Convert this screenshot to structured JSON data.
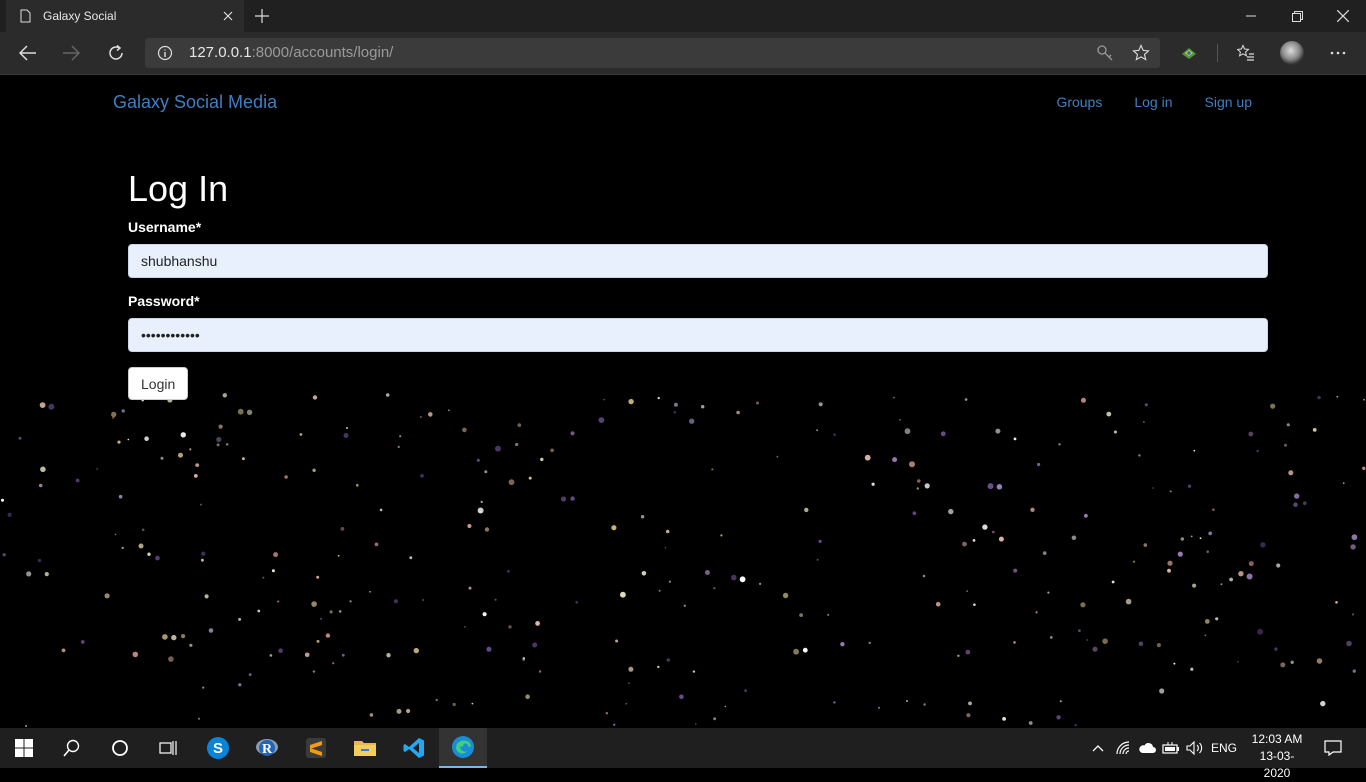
{
  "browser": {
    "tab_title": "Galaxy Social",
    "url_host": "127.0.0.1",
    "url_rest": ":8000/accounts/login/"
  },
  "navbar": {
    "brand": "Galaxy Social Media",
    "links": [
      {
        "label": "Groups"
      },
      {
        "label": "Log in"
      },
      {
        "label": "Sign up"
      }
    ]
  },
  "form": {
    "heading": "Log In",
    "username_label": "Username*",
    "username_value": "shubhanshu",
    "password_label": "Password*",
    "password_value": "••••••••••••",
    "submit_label": "Login"
  },
  "taskbar": {
    "language": "ENG",
    "time": "12:03 AM",
    "date": "13-03-2020"
  },
  "colors": {
    "link": "#3f7fc4",
    "input_bg": "#e8f0fe",
    "page_bg": "#000000"
  }
}
